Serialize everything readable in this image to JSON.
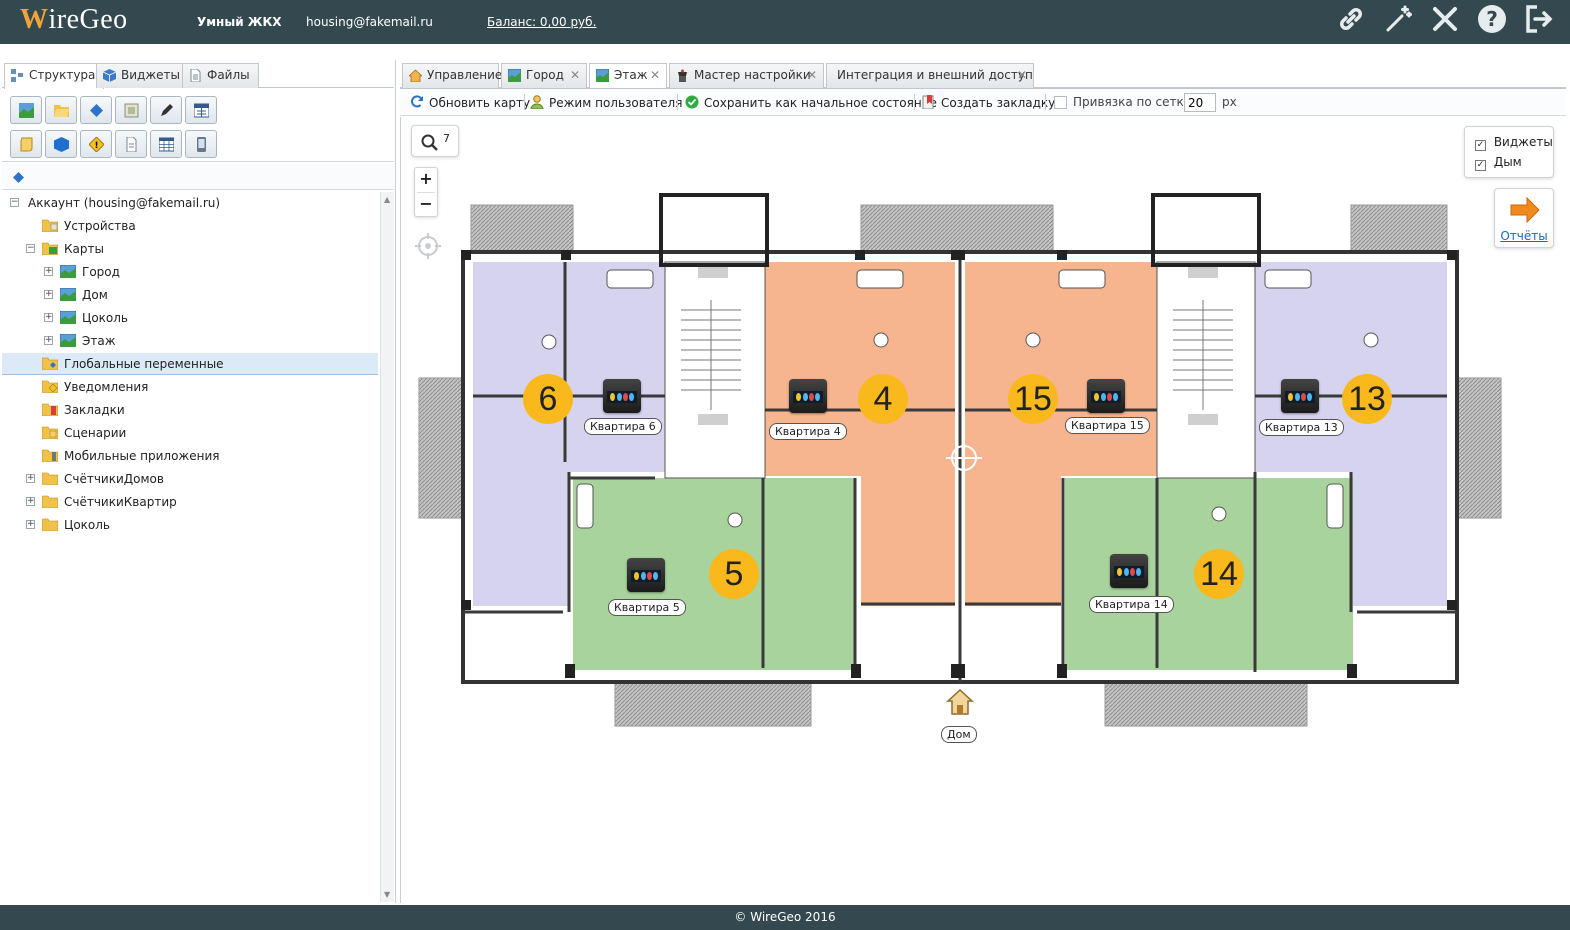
{
  "header": {
    "logo": "WireGeo",
    "app_name": "Умный ЖКХ",
    "user_email": "housing@fakemail.ru",
    "balance": "Баланс: 0,00 руб.",
    "icons": [
      "link-icon",
      "magic-wand-icon",
      "tools-icon",
      "help-icon",
      "logout-icon"
    ]
  },
  "left_tabs": [
    {
      "label": "Структура",
      "icon": "structure-icon",
      "active": true
    },
    {
      "label": "Виджеты",
      "icon": "cube-icon",
      "active": false
    },
    {
      "label": "Файлы",
      "icon": "file-icon",
      "active": false
    }
  ],
  "toolbar_icons": [
    "map-icon",
    "folder-open-icon",
    "diamond-icon",
    "device-icon",
    "pen-icon",
    "calculator-icon",
    "script-icon",
    "cube-icon",
    "warning-icon",
    "document-icon",
    "table-icon",
    "phone-icon"
  ],
  "tree": [
    {
      "label": "Аккаунт (housing@fakemail.ru)",
      "level": 0,
      "expander": "−",
      "icon": "none"
    },
    {
      "label": "Устройства",
      "level": 1,
      "expander": "",
      "icon": "folder-device"
    },
    {
      "label": "Карты",
      "level": 1,
      "expander": "−",
      "icon": "folder-map"
    },
    {
      "label": "Город",
      "level": 2,
      "expander": "+",
      "icon": "map"
    },
    {
      "label": "Дом",
      "level": 2,
      "expander": "+",
      "icon": "map"
    },
    {
      "label": "Цоколь",
      "level": 2,
      "expander": "+",
      "icon": "map"
    },
    {
      "label": "Этаж",
      "level": 2,
      "expander": "+",
      "icon": "map"
    },
    {
      "label": "Глобальные переменные",
      "level": 1,
      "expander": "",
      "icon": "folder-var",
      "selected": true
    },
    {
      "label": "Уведомления",
      "level": 1,
      "expander": "",
      "icon": "folder-warning"
    },
    {
      "label": "Закладки",
      "level": 1,
      "expander": "",
      "icon": "folder-bookmark"
    },
    {
      "label": "Сценарии",
      "level": 1,
      "expander": "",
      "icon": "folder-script"
    },
    {
      "label": "Мобильные приложения",
      "level": 1,
      "expander": "",
      "icon": "folder-mobile"
    },
    {
      "label": "СчётчикиДомов",
      "level": 1,
      "expander": "+",
      "icon": "folder"
    },
    {
      "label": "СчётчикиКвартир",
      "level": 1,
      "expander": "+",
      "icon": "folder"
    },
    {
      "label": "Цоколь",
      "level": 1,
      "expander": "+",
      "icon": "folder"
    }
  ],
  "right_tabs": [
    {
      "label": "Управление",
      "icon": "home-icon",
      "closable": false,
      "active": false
    },
    {
      "label": "Город",
      "icon": "map-icon",
      "closable": true,
      "active": false
    },
    {
      "label": "Этаж",
      "icon": "map-icon",
      "closable": true,
      "active": true
    },
    {
      "label": "Мастер настройки",
      "icon": "wizard-icon",
      "closable": true,
      "active": false
    },
    {
      "label": "Интеграция и внешний доступ",
      "icon": "none",
      "closable": true,
      "active": false
    }
  ],
  "map_toolbar": {
    "refresh": "Обновить карту",
    "user_mode": "Режим пользователя",
    "save_initial": "Сохранить как начальное состояние",
    "bookmark": "Создать закладку",
    "grid_snap": "Привязка по сетке:",
    "grid_value": "20",
    "grid_unit": "px"
  },
  "map_controls": {
    "search_count": "7",
    "zoom_in": "+",
    "zoom_out": "−"
  },
  "layers": [
    {
      "label": "Виджеты",
      "checked": true
    },
    {
      "label": "Дым",
      "checked": true
    }
  ],
  "reports": "Отчёты",
  "apartments": [
    {
      "number": "6",
      "label": "Квартира 6"
    },
    {
      "number": "4",
      "label": "Квартира 4"
    },
    {
      "number": "15",
      "label": "Квартира 15"
    },
    {
      "number": "13",
      "label": "Квартира 13"
    },
    {
      "number": "5",
      "label": "Квартира 5"
    },
    {
      "number": "14",
      "label": "Квартира 14"
    }
  ],
  "house_label": "Дом",
  "colors": {
    "header_bg": "#34494f",
    "badge": "#f9b91d",
    "apt_purple": "#d6d3ee",
    "apt_orange": "#f6b48f",
    "apt_green": "#a9d39c",
    "link": "#1a66c2"
  },
  "footer": "© WireGeo 2016"
}
